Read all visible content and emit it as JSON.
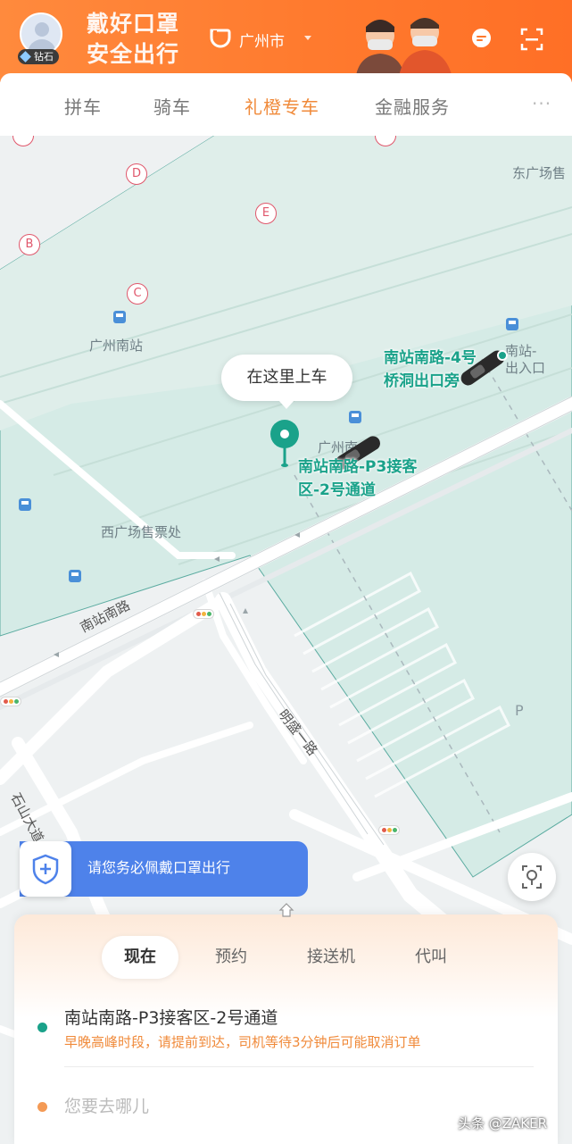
{
  "header": {
    "tier_badge": "钻石",
    "slogan_line1": "戴好口罩",
    "slogan_line2": "安全出行",
    "city": "广州市"
  },
  "tabs": [
    {
      "label": "拼车"
    },
    {
      "label": "骑车"
    },
    {
      "label": "礼橙专车",
      "active": true
    },
    {
      "label": "金融服务"
    }
  ],
  "map": {
    "gates": [
      "D",
      "E",
      "B",
      "C"
    ],
    "labels": {
      "east_square_ticket": "东广场售",
      "guangzhou_south": "广州南站",
      "west_square_ticket": "西广场售票处",
      "nanzhan_road": "南站南路",
      "mingsheng_road": "明盛一路",
      "shishan_avenue": "石山大道",
      "station_exit": "南站-\n出入口",
      "guangzhou_south_short": "广州南"
    },
    "tooltip": "在这里上车",
    "pickup_point": "南站南路-P3接客\n区-2号通道",
    "alt_pickup_point": "南站南路-4号\n桥洞出口旁",
    "parking": "P",
    "colors": {
      "land": "#eef1f2",
      "station": "#d5ebe6",
      "accent": "#1aa28a"
    }
  },
  "notice": {
    "text": "请您务必佩戴口罩出行"
  },
  "booking": {
    "modes": [
      {
        "label": "现在",
        "active": true
      },
      {
        "label": "预约"
      },
      {
        "label": "接送机"
      },
      {
        "label": "代叫"
      }
    ],
    "from": "南站南路-P3接客区-2号通道",
    "from_hint": "早晚高峰时段，请提前到达，司机等待3分钟后可能取消订单",
    "to_placeholder": "您要去哪儿"
  },
  "watermark": "头条 @ZAKER"
}
